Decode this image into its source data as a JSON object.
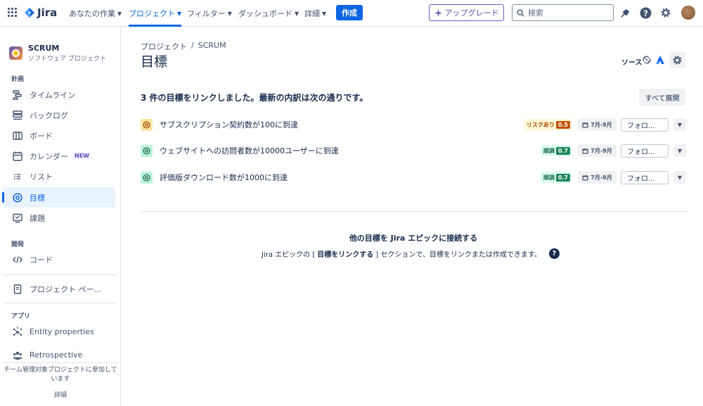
{
  "topnav": {
    "logo_text": "Jira",
    "items": [
      {
        "label": "あなたの作業"
      },
      {
        "label": "プロジェクト"
      },
      {
        "label": "フィルター"
      },
      {
        "label": "ダッシュボード"
      },
      {
        "label": "詳細"
      }
    ],
    "create_label": "作成",
    "upgrade_label": "アップグレード",
    "search_placeholder": "検索"
  },
  "sidebar": {
    "project_name": "SCRUM",
    "project_type": "ソフトウェア プロジェクト",
    "planning_title": "計画",
    "items": [
      {
        "label": "タイムライン",
        "icon": "timeline-icon"
      },
      {
        "label": "バックログ",
        "icon": "backlog-icon"
      },
      {
        "label": "ボード",
        "icon": "board-icon"
      },
      {
        "label": "カレンダー",
        "icon": "calendar-icon",
        "badge": "NEW"
      },
      {
        "label": "リスト",
        "icon": "list-icon"
      },
      {
        "label": "目標",
        "icon": "goals-icon",
        "active": true
      },
      {
        "label": "課題",
        "icon": "issues-icon"
      }
    ],
    "dev_title": "開発",
    "code_label": "コード",
    "project_pages_label": "プロジェクト ペー...",
    "apps_title": "アプリ",
    "app_items": [
      {
        "label": "Entity properties"
      },
      {
        "label": "Retrospective"
      }
    ],
    "footer_text": "チーム管理対象プロジェクトに参加して",
    "footer_text2": "います",
    "footer_link": "詳細"
  },
  "main": {
    "breadcrumb": [
      "プロジェクト",
      "/",
      "SCRUM"
    ],
    "title": "目標",
    "source_label": "ソース",
    "summary": "3 件の目標をリンクしました。最新の内訳は次の通りです。",
    "expand_label": "すべて展開",
    "goals": [
      {
        "name": "サブスクリプション契約数が100に到達",
        "status": "リスクあり",
        "score": "0.5",
        "date": "7月-9月",
        "follow": "フォロ..."
      },
      {
        "name": "ウェブサイトへの訪問者数が10000ユーザーに到達",
        "status": "順調",
        "score": "0.7",
        "date": "7月-9月",
        "follow": "フォロ..."
      },
      {
        "name": "評価版ダウンロード数が1000に到達",
        "status": "順調",
        "score": "0.7",
        "date": "7月-9月",
        "follow": "フォロ..."
      }
    ],
    "connect_title": "他の目標を Jira エピックに接続する",
    "connect_desc_pre": "Jira エピックの [",
    "connect_desc_bold": "目標をリンクする",
    "connect_desc_post": "] セクションで、目標をリンクまたは作成できます。"
  },
  "colors": {
    "brand": "#0c66e4",
    "at_risk_bg": "#fff7d6",
    "at_risk_text": "#a54800",
    "at_risk_score": "#c25100",
    "on_track_bg": "#dcfff1",
    "on_track_text": "#216e4e",
    "on_track_score": "#1f845a"
  }
}
